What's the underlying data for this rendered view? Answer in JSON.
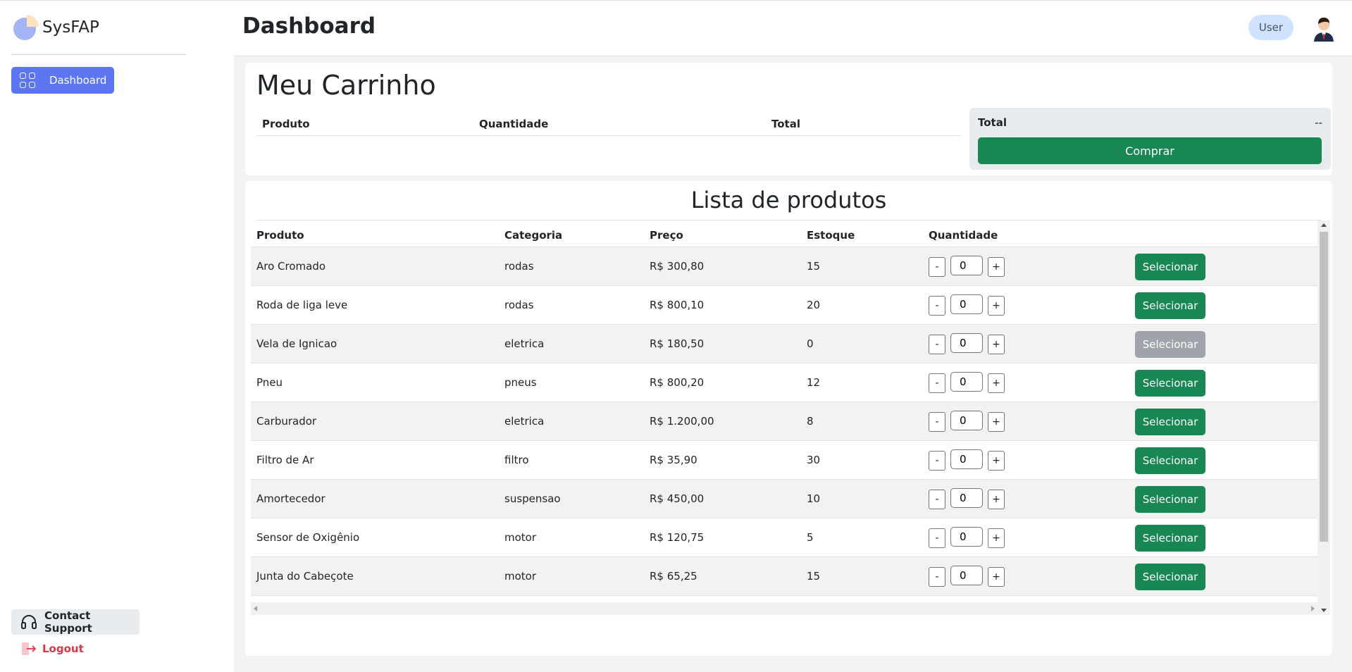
{
  "app": {
    "name": "SysFAP"
  },
  "sidebar": {
    "nav": [
      {
        "label": "Dashboard",
        "icon": "grid-icon",
        "active": true
      }
    ],
    "support_label": "Contact Support",
    "logout_label": "Logout"
  },
  "header": {
    "title": "Dashboard",
    "user_label": "User"
  },
  "cart": {
    "title": "Meu Carrinho",
    "columns": [
      "Produto",
      "Quantidade",
      "Total"
    ],
    "summary_label": "Total",
    "summary_value": "--",
    "buy_label": "Comprar"
  },
  "products": {
    "title": "Lista de produtos",
    "columns": [
      "Produto",
      "Categoria",
      "Preço",
      "Estoque",
      "Quantidade"
    ],
    "select_label": "Selecionar",
    "minus_label": "-",
    "plus_label": "+",
    "rows": [
      {
        "name": "Aro Cromado",
        "category": "rodas",
        "price": "R$ 300,80",
        "stock": "15",
        "qty": "0",
        "enabled": true
      },
      {
        "name": "Roda de liga leve",
        "category": "rodas",
        "price": "R$ 800,10",
        "stock": "20",
        "qty": "0",
        "enabled": true
      },
      {
        "name": "Vela de Ignicao",
        "category": "eletrica",
        "price": "R$ 180,50",
        "stock": "0",
        "qty": "0",
        "enabled": false
      },
      {
        "name": "Pneu",
        "category": "pneus",
        "price": "R$ 800,20",
        "stock": "12",
        "qty": "0",
        "enabled": true
      },
      {
        "name": "Carburador",
        "category": "eletrica",
        "price": "R$ 1.200,00",
        "stock": "8",
        "qty": "0",
        "enabled": true
      },
      {
        "name": "Filtro de Ar",
        "category": "filtro",
        "price": "R$ 35,90",
        "stock": "30",
        "qty": "0",
        "enabled": true
      },
      {
        "name": "Amortecedor",
        "category": "suspensao",
        "price": "R$ 450,00",
        "stock": "10",
        "qty": "0",
        "enabled": true
      },
      {
        "name": "Sensor de Oxigênio",
        "category": "motor",
        "price": "R$ 120,75",
        "stock": "5",
        "qty": "0",
        "enabled": true
      },
      {
        "name": "Junta do Cabeçote",
        "category": "motor",
        "price": "R$ 65,25",
        "stock": "15",
        "qty": "0",
        "enabled": true
      },
      {
        "name": "",
        "category": "",
        "price": "",
        "stock": "",
        "qty": "",
        "enabled": true
      }
    ]
  },
  "colors": {
    "primary": "#5b76f0",
    "success": "#198754",
    "danger": "#dc3545",
    "disabled": "#9ea4aa"
  }
}
